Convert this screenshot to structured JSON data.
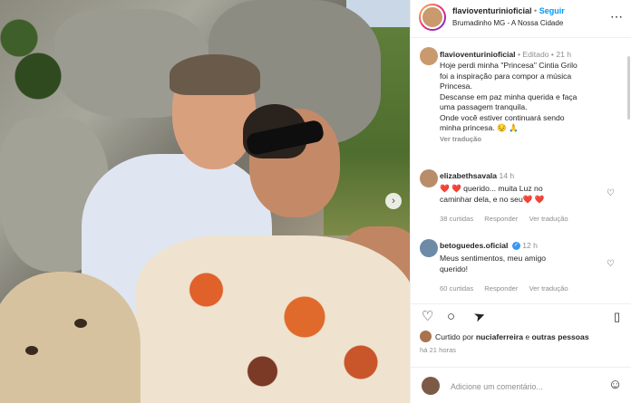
{
  "header": {
    "username": "flavioventurinioficial",
    "dot": "•",
    "follow_label": "Seguir",
    "location": "Brumadinho MG - A Nossa Cidade"
  },
  "caption": {
    "username": "flavioventurinioficial",
    "dot": "•",
    "edited": "Editado",
    "time": "21 h",
    "lines": [
      "Hoje perdi minha \"Princesa\" Cintia Grilo",
      "foi a inspiração para compor a música",
      "Princesa.",
      "Descanse em paz minha querida e faça",
      "uma passagem tranquila.",
      "Onde você estiver continuará sendo",
      "minha princesa. 😔 🙏"
    ],
    "see_translation": "Ver tradução"
  },
  "comments": [
    {
      "username": "elizabethsavala",
      "verified": false,
      "time": "14 h",
      "line1": "❤️ ❤️ querido... muita Luz no",
      "line2": "caminhar dela, e no seu❤️ ❤️",
      "likes": "38 curtidas",
      "reply": "Responder",
      "translate": "Ver tradução"
    },
    {
      "username": "betoguedes.oficial",
      "verified": true,
      "time": "12 h",
      "line1": "Meus sentimentos, meu amigo",
      "line2": "querido!",
      "likes": "60 curtidas",
      "reply": "Responder",
      "translate": "Ver tradução"
    }
  ],
  "liked_by": {
    "prefix": "Curtido por",
    "user": "nuciaferreira",
    "suffix": "e",
    "others": "outras pessoas"
  },
  "post_time": "há 21 horas",
  "add_comment_placeholder": "Adicione um comentário...",
  "icons": {
    "like": "heart-icon",
    "comment": "comment-icon",
    "share": "share-icon",
    "save": "bookmark-icon",
    "emoji": "smiley-icon",
    "next": "chevron-right-icon"
  }
}
